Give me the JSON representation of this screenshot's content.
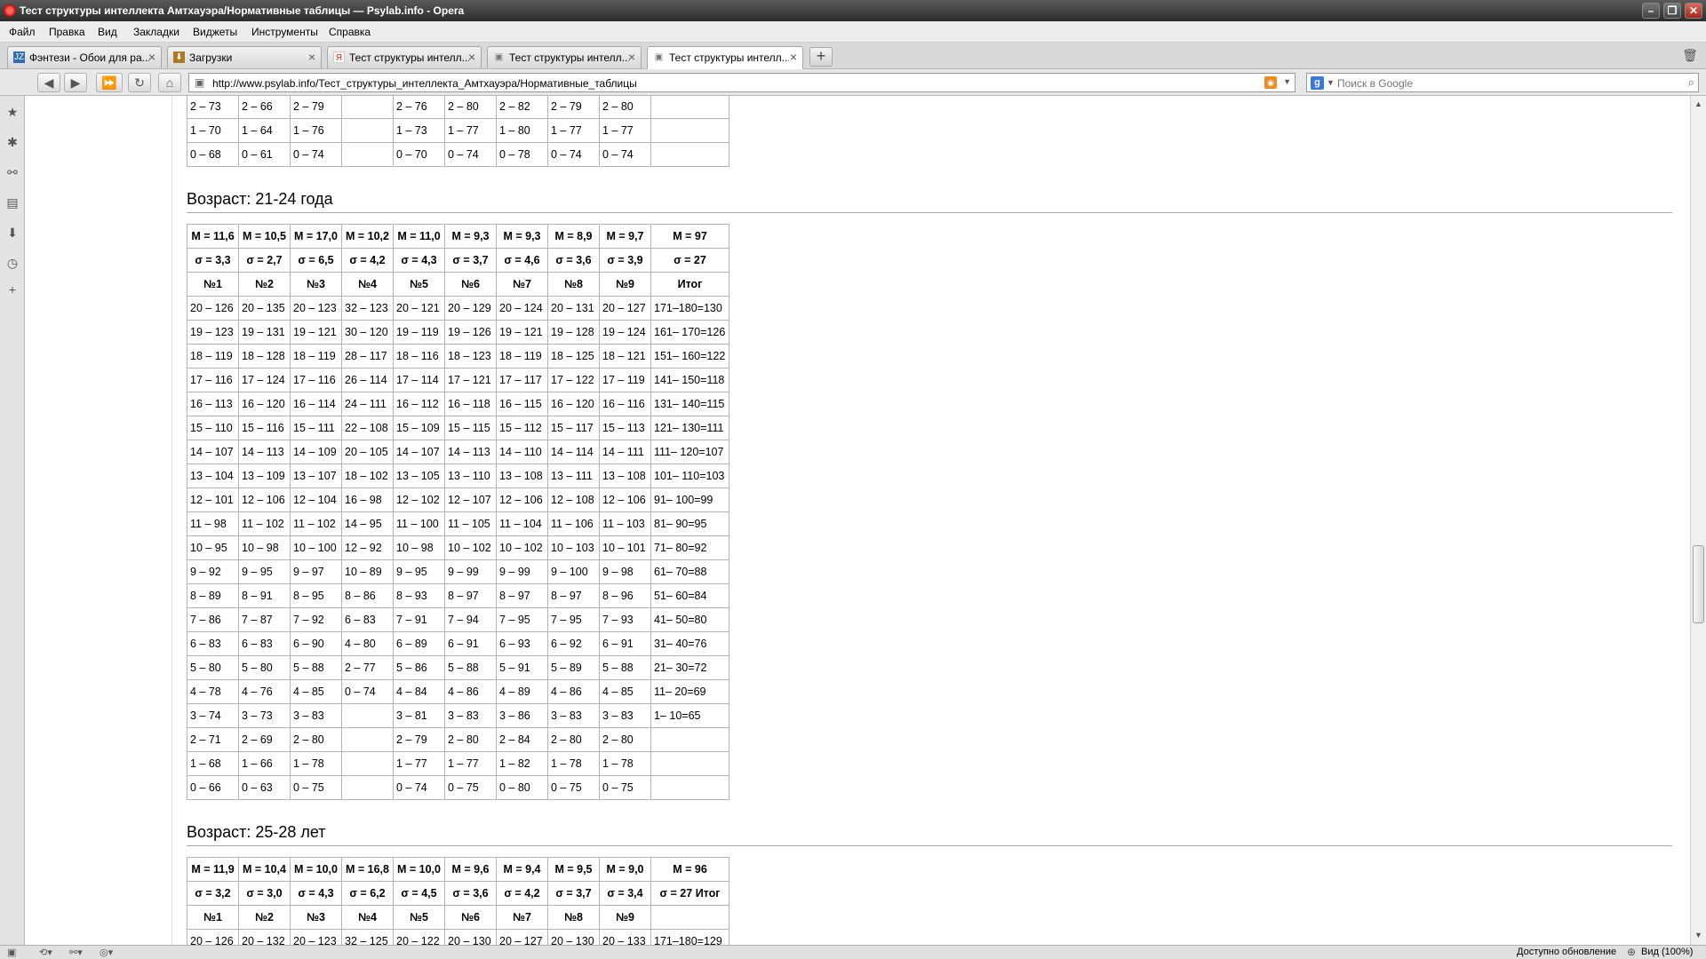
{
  "window": {
    "title": "Тест структуры интеллекта Амтхауэра/Нормативные таблицы — Psylab.info - Opera",
    "buttons": {
      "minimize": "–",
      "maximize": "❐",
      "close": "✕"
    }
  },
  "menu": [
    "Файл",
    "Правка",
    "Вид",
    "Закладки",
    "Виджеты",
    "Инструменты",
    "Справка"
  ],
  "tabs": [
    {
      "label": "Фэнтези - Обои для ра...",
      "favicon": "wallpaper-site-icon",
      "favicon_text": "JZ",
      "favicon_color": "#2f6db5"
    },
    {
      "label": "Загрузки",
      "favicon": "downloads-icon",
      "favicon_text": "⬇",
      "favicon_color": "#b07a20"
    },
    {
      "label": "Тест структуры интелл...",
      "favicon": "yandex-icon",
      "favicon_text": "Я",
      "favicon_color": "#d22"
    },
    {
      "label": "Тест структуры интелл...",
      "favicon": "page-icon",
      "favicon_text": "▣",
      "favicon_color": "#777"
    },
    {
      "label": "Тест структуры интелл...",
      "favicon": "page-icon",
      "favicon_text": "▣",
      "favicon_color": "#777"
    }
  ],
  "address": {
    "url": "http://www.psylab.info/Тест_структуры_интеллекта_Амтхауэра/Нормативные_таблицы"
  },
  "search": {
    "placeholder": "Поиск в Google"
  },
  "content": {
    "table_top": {
      "rows": [
        [
          "2 – 73",
          "2 – 66",
          "2 – 79",
          "",
          "2 – 76",
          "2 – 80",
          "2 – 82",
          "2 – 79",
          "2 – 80",
          ""
        ],
        [
          "1 – 70",
          "1 – 64",
          "1 – 76",
          "",
          "1 – 73",
          "1 – 77",
          "1 – 80",
          "1 – 77",
          "1 – 77",
          ""
        ],
        [
          "0 – 68",
          "0 – 61",
          "0 – 74",
          "",
          "0 – 70",
          "0 – 74",
          "0 – 78",
          "0 – 74",
          "0 – 74",
          ""
        ]
      ]
    },
    "section_21_24": {
      "heading": "Возраст: 21-24 года",
      "head_rows": [
        [
          "M = 11,6",
          "M = 10,5",
          "M = 17,0",
          "M = 10,2",
          "M = 11,0",
          "M = 9,3",
          "M = 9,3",
          "M = 8,9",
          "M = 9,7",
          "M = 97"
        ],
        [
          "σ = 3,3",
          "σ = 2,7",
          "σ = 6,5",
          "σ = 4,2",
          "σ = 4,3",
          "σ = 3,7",
          "σ = 4,6",
          "σ = 3,6",
          "σ = 3,9",
          "σ = 27"
        ],
        [
          "№1",
          "№2",
          "№3",
          "№4",
          "№5",
          "№6",
          "№7",
          "№8",
          "№9",
          "Итог"
        ]
      ],
      "rows": [
        [
          "20 – 126",
          "20 – 135",
          "20 – 123",
          "32 – 123",
          "20 – 121",
          "20 – 129",
          "20 – 124",
          "20 – 131",
          "20 – 127",
          "171–180=130"
        ],
        [
          "19 – 123",
          "19 – 131",
          "19 – 121",
          "30 – 120",
          "19 – 119",
          "19 – 126",
          "19 – 121",
          "19 – 128",
          "19 – 124",
          "161– 170=126"
        ],
        [
          "18 – 119",
          "18 – 128",
          "18 – 119",
          "28 – 117",
          "18 – 116",
          "18 – 123",
          "18 – 119",
          "18 – 125",
          "18 – 121",
          "151– 160=122"
        ],
        [
          "17 – 116",
          "17 – 124",
          "17 – 116",
          "26 – 114",
          "17 – 114",
          "17 – 121",
          "17 – 117",
          "17 – 122",
          "17 – 119",
          "141– 150=118"
        ],
        [
          "16 – 113",
          "16 – 120",
          "16 – 114",
          "24 – 111",
          "16 – 112",
          "16 – 118",
          "16 – 115",
          "16 – 120",
          "16 – 116",
          "131– 140=115"
        ],
        [
          "15 – 110",
          "15 – 116",
          "15 – 111",
          "22 – 108",
          "15 – 109",
          "15 – 115",
          "15 – 112",
          "15 – 117",
          "15 – 113",
          "121– 130=111"
        ],
        [
          "14 – 107",
          "14 – 113",
          "14 – 109",
          "20 – 105",
          "14 – 107",
          "14 – 113",
          "14 – 110",
          "14 – 114",
          "14 – 111",
          "111– 120=107"
        ],
        [
          "13 – 104",
          "13 – 109",
          "13 – 107",
          "18 – 102",
          "13 – 105",
          "13 – 110",
          "13 – 108",
          "13 – 111",
          "13 – 108",
          "101– 110=103"
        ],
        [
          "12 – 101",
          "12 – 106",
          "12 – 104",
          "16 – 98",
          "12 – 102",
          "12 – 107",
          "12 – 106",
          "12 – 108",
          "12 – 106",
          "91– 100=99"
        ],
        [
          "11 – 98",
          "11 – 102",
          "11 – 102",
          "14 – 95",
          "11 – 100",
          "11 – 105",
          "11 – 104",
          "11 – 106",
          "11 – 103",
          "81– 90=95"
        ],
        [
          "10 – 95",
          "10 – 98",
          "10 – 100",
          "12 – 92",
          "10 – 98",
          "10 – 102",
          "10 – 102",
          "10 – 103",
          "10 – 101",
          "71– 80=92"
        ],
        [
          "9 – 92",
          "9 – 95",
          "9 – 97",
          "10 – 89",
          "9 – 95",
          "9 – 99",
          "9 – 99",
          "9 – 100",
          "9 – 98",
          "61– 70=88"
        ],
        [
          "8 – 89",
          "8 – 91",
          "8 – 95",
          "8 – 86",
          "8 – 93",
          "8 – 97",
          "8 – 97",
          "8 – 97",
          "8 – 96",
          "51– 60=84"
        ],
        [
          "7 – 86",
          "7 – 87",
          "7 – 92",
          "6 – 83",
          "7 – 91",
          "7 – 94",
          "7 – 95",
          "7 – 95",
          "7 – 93",
          "41– 50=80"
        ],
        [
          "6 – 83",
          "6 – 83",
          "6 – 90",
          "4 – 80",
          "6 – 89",
          "6 – 91",
          "6 – 93",
          "6 – 92",
          "6 – 91",
          "31– 40=76"
        ],
        [
          "5 – 80",
          "5 – 80",
          "5 – 88",
          "2 – 77",
          "5 – 86",
          "5 – 88",
          "5 – 91",
          "5 – 89",
          "5 – 88",
          "21– 30=72"
        ],
        [
          "4 – 78",
          "4 – 76",
          "4 – 85",
          "0 – 74",
          "4 – 84",
          "4 – 86",
          "4 – 89",
          "4 – 86",
          "4 – 85",
          "11– 20=69"
        ],
        [
          "3 – 74",
          "3 – 73",
          "3 – 83",
          "",
          "3 – 81",
          "3 – 83",
          "3 – 86",
          "3 – 83",
          "3 – 83",
          "1– 10=65"
        ],
        [
          "2 – 71",
          "2 – 69",
          "2 – 80",
          "",
          "2 – 79",
          "2 – 80",
          "2 – 84",
          "2 – 80",
          "2 – 80",
          ""
        ],
        [
          "1 – 68",
          "1 – 66",
          "1 – 78",
          "",
          "1 – 77",
          "1 – 77",
          "1 – 82",
          "1 – 78",
          "1 – 78",
          ""
        ],
        [
          "0 – 66",
          "0 – 63",
          "0 – 75",
          "",
          "0 – 74",
          "0 – 75",
          "0 – 80",
          "0 – 75",
          "0 – 75",
          ""
        ]
      ]
    },
    "section_25_28": {
      "heading": "Возраст: 25-28 лет",
      "head_rows": [
        [
          "M = 11,9",
          "M = 10,4",
          "M = 10,0",
          "M = 16,8",
          "M = 10,0",
          "M = 9,6",
          "M = 9,4",
          "M = 9,5",
          "M = 9,0",
          "M = 96"
        ],
        [
          "σ = 3,2",
          "σ = 3,0",
          "σ = 4,3",
          "σ = 6,2",
          "σ = 4,5",
          "σ = 3,6",
          "σ = 4,2",
          "σ = 3,7",
          "σ = 3,4",
          "σ = 27 Итог"
        ],
        [
          "№1",
          "№2",
          "№3",
          "№4",
          "№5",
          "№6",
          "№7",
          "№8",
          "№9",
          ""
        ]
      ],
      "rows": [
        [
          "20 – 126",
          "20 – 132",
          "20 – 123",
          "32 – 125",
          "20 – 122",
          "20 – 130",
          "20 – 127",
          "20 – 130",
          "20 – 133",
          "171–180=129"
        ]
      ]
    }
  },
  "status": {
    "update_text": "Доступно обновление",
    "zoom_text": "Вид (100%)"
  }
}
